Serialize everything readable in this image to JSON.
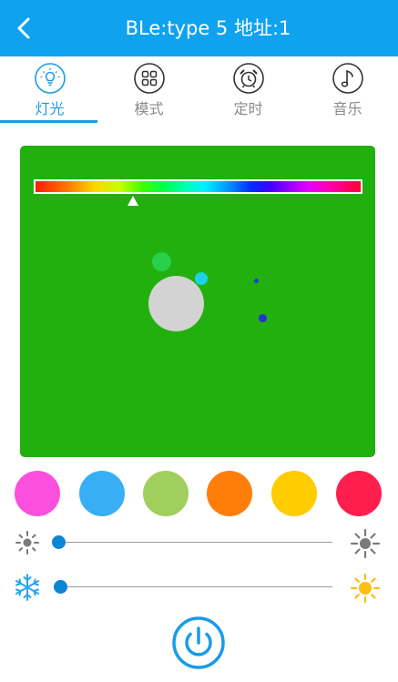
{
  "header": {
    "title": "BLe:type 5 地址:1",
    "back_icon": "chevron-left-icon",
    "background": "#0ea2ef"
  },
  "tabs": [
    {
      "label": "灯光",
      "icon": "lightbulb-icon",
      "active": true
    },
    {
      "label": "模式",
      "icon": "grid-icon",
      "active": false
    },
    {
      "label": "定时",
      "icon": "alarm-clock-icon",
      "active": false
    },
    {
      "label": "音乐",
      "icon": "music-note-icon",
      "active": false
    }
  ],
  "accent_color": "#1a9be8",
  "color_panel": {
    "background": "#22b00e",
    "spectrum_position": 0.3
  },
  "swatches": [
    "#fd4fdd",
    "#38aff5",
    "#a1cf5d",
    "#ff7e0a",
    "#ffcc00",
    "#ff1e4e"
  ],
  "sliders": {
    "brightness": {
      "value": 0.0,
      "left_icon": "brightness-low-icon",
      "right_icon": "brightness-high-icon"
    },
    "color_temperature": {
      "value": 0.0,
      "left_icon": "snowflake-icon",
      "right_icon": "sun-icon"
    }
  },
  "power": {
    "icon": "power-icon"
  }
}
